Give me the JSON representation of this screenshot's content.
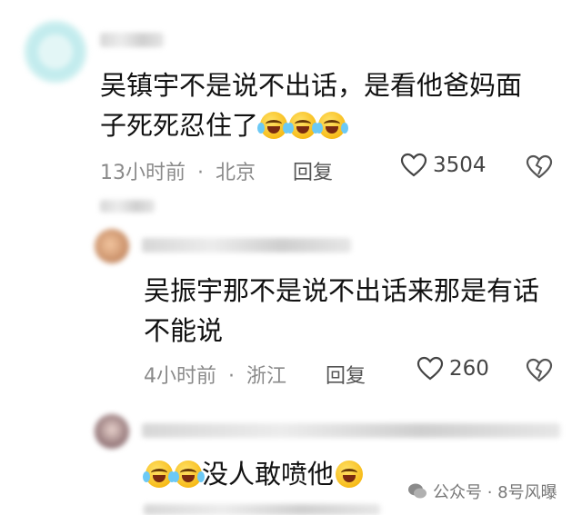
{
  "comments": [
    {
      "text_line1": "吴镇宇不是说不出话，是看他爸妈面",
      "text_line2": "子死死忍住了",
      "time": "13小时前",
      "location": "北京",
      "reply": "回复",
      "likes": "3504"
    },
    {
      "text_line1": "吴振宇那不是说不出话来那是有话",
      "text_line2": "不能说",
      "time": "4小时前",
      "location": "浙江",
      "reply": "回复",
      "likes": "260"
    },
    {
      "text": "没人敢喷他"
    }
  ],
  "separator": "·",
  "watermark": "公众号 · 8号风曝",
  "icons": {
    "like": "heart-outline-icon",
    "dislike": "broken-heart-icon",
    "emoji": "laughing-crying-emoji",
    "watermark": "wechat-icon"
  },
  "colors": {
    "text": "#111111",
    "meta": "#8a8a8a"
  }
}
